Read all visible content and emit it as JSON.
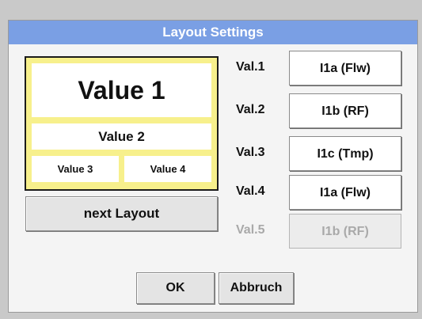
{
  "dialog": {
    "title": "Layout Settings"
  },
  "preview": {
    "value1": "Value 1",
    "value2": "Value 2",
    "value3": "Value 3",
    "value4": "Value 4"
  },
  "buttons": {
    "next_layout": "next Layout",
    "ok": "OK",
    "cancel": "Abbruch"
  },
  "values": [
    {
      "label": "Val.1",
      "channel": "I1a (Flw)",
      "enabled": true
    },
    {
      "label": "Val.2",
      "channel": "I1b (RF)",
      "enabled": true
    },
    {
      "label": "Val.3",
      "channel": "I1c (Tmp)",
      "enabled": true
    },
    {
      "label": "Val.4",
      "channel": "I1a (Flw)",
      "enabled": true
    },
    {
      "label": "Val.5",
      "channel": "I1b (RF)",
      "enabled": false
    }
  ],
  "colors": {
    "titlebar": "#7a9fe4",
    "preview_background": "#f7f08c",
    "disabled_text": "#a9a9a9"
  }
}
